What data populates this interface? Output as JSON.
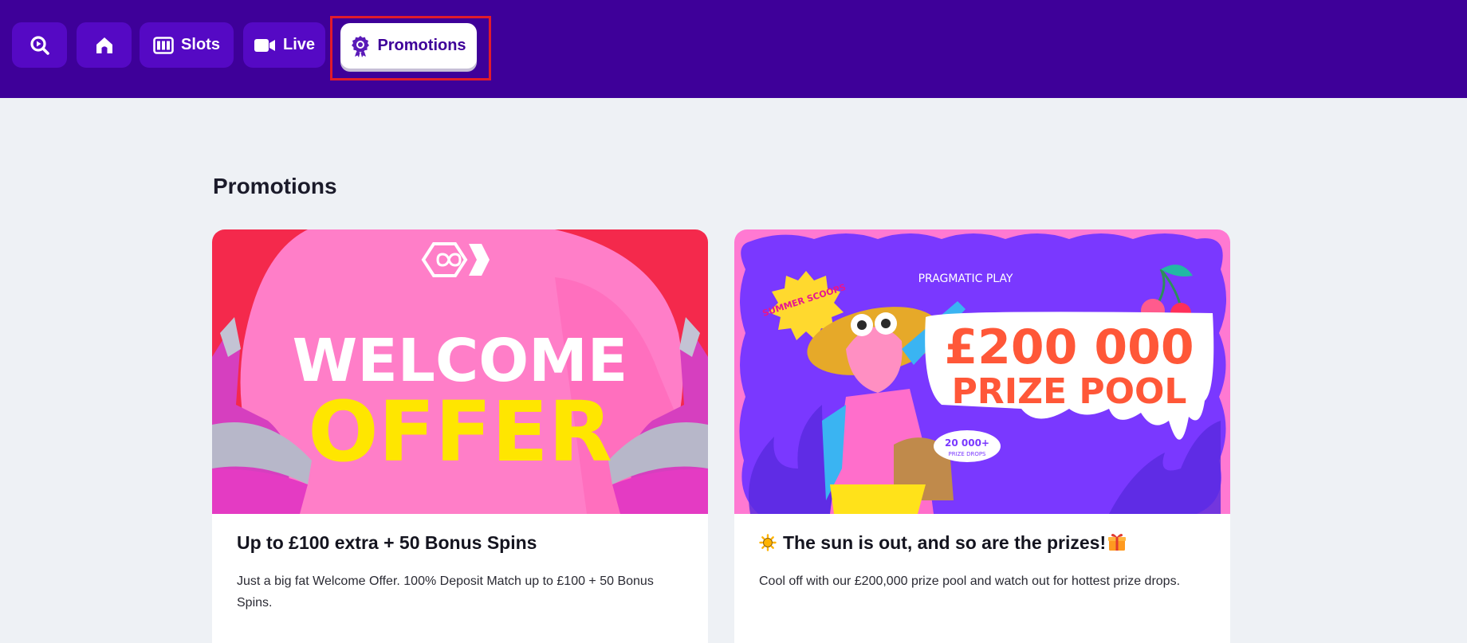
{
  "nav": {
    "search_icon": "casino-search-icon",
    "home_icon": "home-icon",
    "slots_label": "Slots",
    "live_label": "Live",
    "promotions_label": "Promotions"
  },
  "page": {
    "title": "Promotions"
  },
  "cards": [
    {
      "banner": {
        "top_text": "WELCOME",
        "bottom_text": "OFFER"
      },
      "title": "Up to £100 extra + 50 Bonus Spins",
      "description": "Just a big fat Welcome Offer. 100% Deposit Match up to £100 + 50 Bonus Spins."
    },
    {
      "banner": {
        "brand": "PRAGMATIC PLAY",
        "badge": "SUMMER SCOOPS",
        "amount": "£200 000",
        "subtitle": "PRIZE POOL",
        "drops_count": "20 000+",
        "drops_label": "PRIZE DROPS"
      },
      "title": "The sun is out, and so are the prizes!",
      "description": "Cool off with our £200,000 prize pool and watch out for hottest prize drops."
    }
  ],
  "colors": {
    "topbar": "#3e0099",
    "nav_button": "#5509c4",
    "highlight": "#e11b2b",
    "page_bg": "#eef1f5"
  }
}
